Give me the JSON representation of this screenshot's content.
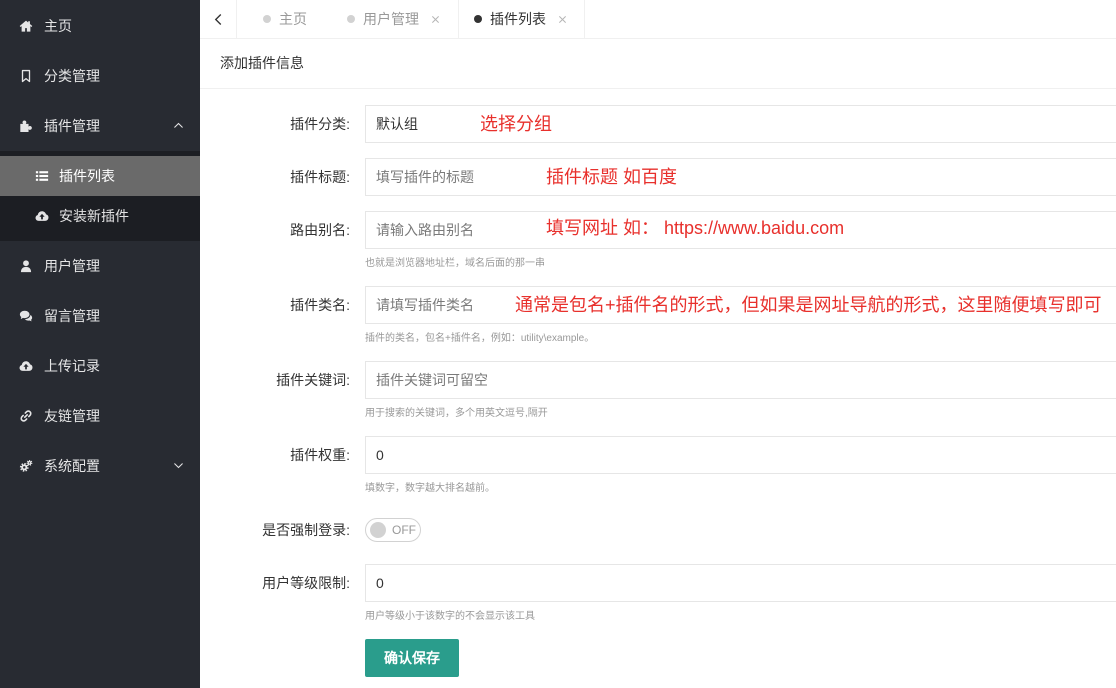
{
  "colors": {
    "sidebar_bg": "#282b32",
    "sidebar_sub_bg": "#1c1e23",
    "sidebar_active_bg": "#6a6a6a",
    "accent": "#2a9d8c",
    "annotation": "#e8302c"
  },
  "sidebar": {
    "items": [
      {
        "label": "主页",
        "icon": "home-icon"
      },
      {
        "label": "分类管理",
        "icon": "bookmark-icon"
      },
      {
        "label": "插件管理",
        "icon": "puzzle-icon",
        "expanded": true,
        "children": [
          {
            "label": "插件列表",
            "icon": "list-icon",
            "active": true
          },
          {
            "label": "安装新插件",
            "icon": "cloud-upload-icon",
            "active": false
          }
        ]
      },
      {
        "label": "用户管理",
        "icon": "user-icon"
      },
      {
        "label": "留言管理",
        "icon": "comments-icon"
      },
      {
        "label": "上传记录",
        "icon": "cloud-upload-icon"
      },
      {
        "label": "友链管理",
        "icon": "link-icon"
      },
      {
        "label": "系统配置",
        "icon": "cogs-icon",
        "expanded": false
      }
    ]
  },
  "tabs": [
    {
      "label": "主页",
      "active": false,
      "closable": false
    },
    {
      "label": "用户管理",
      "active": false,
      "closable": true
    },
    {
      "label": "插件列表",
      "active": true,
      "closable": true
    }
  ],
  "card": {
    "title": "添加插件信息"
  },
  "form": {
    "category": {
      "label": "插件分类:",
      "value": "默认组",
      "annotation": "选择分组"
    },
    "title": {
      "label": "插件标题:",
      "value": "",
      "placeholder": "填写插件的标题",
      "annotation": "插件标题 如百度"
    },
    "route_alias": {
      "label": "路由别名:",
      "value": "",
      "placeholder": "请输入路由别名",
      "help": "也就是浏览器地址栏，域名后面的那一串",
      "annotation": "填写网址 如： https://www.baidu.com"
    },
    "class_name": {
      "label": "插件类名:",
      "value": "",
      "placeholder": "请填写插件类名",
      "help": "插件的类名，包名+插件名，例如：utility\\example。",
      "annotation": "通常是包名+插件名的形式，但如果是网址导航的形式，这里随便填写即可"
    },
    "keywords": {
      "label": "插件关键词:",
      "value": "",
      "placeholder": "插件关键词可留空",
      "help": "用于搜索的关键词，多个用英文逗号,隔开"
    },
    "weight": {
      "label": "插件权重:",
      "value": "0",
      "help": "填数字，数字越大排名越前。"
    },
    "force_login": {
      "label": "是否强制登录:",
      "state": "OFF"
    },
    "level_limit": {
      "label": "用户等级限制:",
      "value": "0",
      "help": "用户等级小于该数字的不会显示该工具"
    },
    "submit": {
      "label": "确认保存"
    }
  }
}
